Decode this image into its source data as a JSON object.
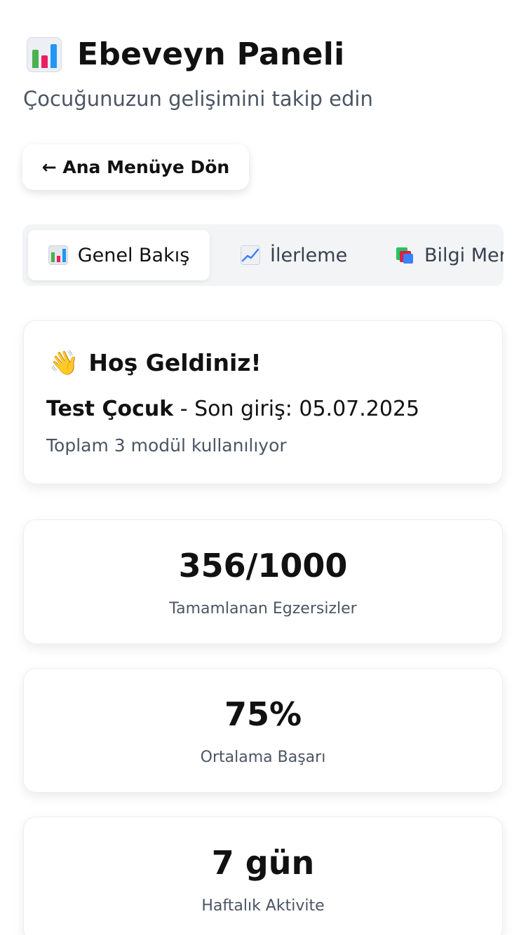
{
  "header": {
    "title": "Ebeveyn Paneli",
    "subtitle": "Çocuğunuzun gelişimini takip edin",
    "icon": "bar-chart-icon"
  },
  "back_button": {
    "label": "← Ana Menüye Dön"
  },
  "tabs": [
    {
      "label": "Genel Bakış",
      "icon": "bar-chart-icon",
      "active": true
    },
    {
      "label": "İlerleme",
      "icon": "trend-up-icon",
      "active": false
    },
    {
      "label": "Bilgi Mer",
      "icon": "books-icon",
      "active": false
    }
  ],
  "welcome": {
    "icon": "waving-hand-icon",
    "title": "Hoş Geldiniz!",
    "child_name": "Test Çocuk",
    "last_login_text": " - Son giriş: 05.07.2025",
    "modules_note": "Toplam 3 modül kullanılıyor"
  },
  "stats": [
    {
      "value": "356/1000",
      "label": "Tamamlanan Egzersizler"
    },
    {
      "value": "75%",
      "label": "Ortalama Başarı"
    },
    {
      "value": "7 gün",
      "label": "Haftalık Aktivite"
    }
  ],
  "colors": {
    "text_primary": "#111111",
    "text_secondary": "#4b5563",
    "tab_bar_bg": "#f3f4f6",
    "card_border": "#eceef2"
  }
}
